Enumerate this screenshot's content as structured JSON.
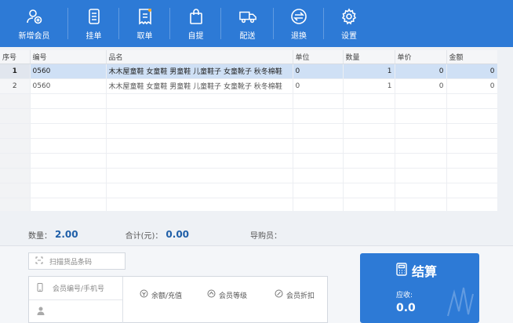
{
  "toolbar": {
    "buttons": [
      {
        "label": "新增会员",
        "icon": "add-member-icon"
      },
      {
        "label": "挂单",
        "icon": "hold-order-icon"
      },
      {
        "label": "取单",
        "icon": "retrieve-order-icon"
      },
      {
        "label": "自提",
        "icon": "pickup-bag-icon"
      },
      {
        "label": "配送",
        "icon": "delivery-truck-icon"
      },
      {
        "label": "退换",
        "icon": "return-exchange-icon"
      },
      {
        "label": "设置",
        "icon": "gear-icon"
      }
    ]
  },
  "grid": {
    "columns": [
      "序号",
      "编号",
      "品名",
      "单位",
      "数量",
      "单价",
      "金额"
    ],
    "rows": [
      {
        "seq": "1",
        "code": "0560",
        "name": "木木屋童鞋 女童鞋 男童鞋 儿童鞋子 女童靴子 秋冬棉鞋",
        "unit": "0",
        "qty": "1",
        "price": "0",
        "amount": "0"
      },
      {
        "seq": "2",
        "code": "0560",
        "name": "木木屋童鞋 女童鞋 男童鞋 儿童鞋子 女童靴子 秋冬棉鞋",
        "unit": "0",
        "qty": "1",
        "price": "0",
        "amount": "0"
      }
    ]
  },
  "summary": {
    "qty_label": "数量：",
    "qty_value": "2.00",
    "total_label": "合计(元)：",
    "total_value": "0.00",
    "guide_label": "导购员："
  },
  "scan": {
    "placeholder": "扫描货品条码"
  },
  "member": {
    "id_placeholder": "会员编号/手机号",
    "name_placeholder": "",
    "balance_label": "余额/充值",
    "level_label": "会员等级",
    "discount_label": "会员折扣"
  },
  "checkout": {
    "title": "结算",
    "due_label": "应收:",
    "due_value": "0.0"
  },
  "colors": {
    "toolbar": "#2d7ad6",
    "selected_row": "#cfe0f5",
    "accent_text": "#1f5fa8"
  }
}
